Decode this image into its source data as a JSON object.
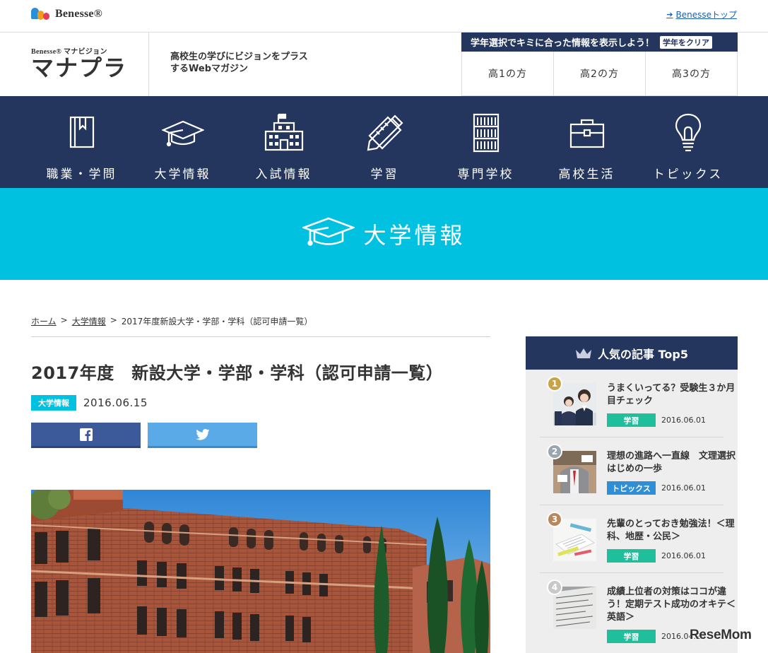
{
  "topbar": {
    "brand": "Benesse®",
    "top_link": "Benesseトップ"
  },
  "header": {
    "logo_small": "Benesse® マナビジョン",
    "logo_big": "マナプラ",
    "tagline": "高校生の学びにビジョンをプラスするWebマガジン",
    "grade_prompt": "学年選択でキミに合った情報を表示しよう！",
    "grade_clear": "学年をクリア",
    "grades": [
      "高1の方",
      "高2の方",
      "高3の方"
    ]
  },
  "nav": {
    "items": [
      {
        "label": "職業・学問",
        "icon": "book-icon"
      },
      {
        "label": "大学情報",
        "icon": "mortarboard-icon"
      },
      {
        "label": "入試情報",
        "icon": "school-building-icon"
      },
      {
        "label": "学習",
        "icon": "pencil-ruler-icon"
      },
      {
        "label": "専門学校",
        "icon": "bookshelf-icon"
      },
      {
        "label": "高校生活",
        "icon": "briefcase-icon"
      },
      {
        "label": "トピックス",
        "icon": "lightbulb-icon"
      }
    ]
  },
  "banner": {
    "title": "大学情報"
  },
  "breadcrumb": {
    "home": "ホーム",
    "sep": ">",
    "category": "大学情報",
    "current": "2017年度新設大学・学部・学科（認可申請一覧）"
  },
  "article": {
    "title": "2017年度　新設大学・学部・学科（認可申請一覧）",
    "category": "大学情報",
    "date": "2016.06.15"
  },
  "ranking": {
    "title": "人気の記事 Top5",
    "items": [
      {
        "rank": "1",
        "title": "うまくいってる？受験生３か月目チェック",
        "tag": "学習",
        "date": "2016.06.01"
      },
      {
        "rank": "2",
        "title": "理想の進路へ一直線　文理選択はじめの一歩",
        "tag": "トピックス",
        "date": "2016.06.01"
      },
      {
        "rank": "3",
        "title": "先輩のとっておき勉強法！＜理科、地歴・公民＞",
        "tag": "学習",
        "date": "2016.06.01"
      },
      {
        "rank": "4",
        "title": "成績上位者の対策はココが違う！定期テスト成功のオキテ＜英語＞",
        "tag": "学習",
        "date": "2016.04.28"
      }
    ]
  },
  "colors": {
    "navy": "#24355e",
    "cyan": "#00c1e0",
    "tag_green": "#1fbf9c",
    "tag_blue": "#2e8fd6",
    "gold": "#c9a445",
    "silver": "#9aa5ad",
    "bronze": "#b9875a",
    "rank4": "#c8c8c8"
  },
  "watermark": "ReseMom"
}
